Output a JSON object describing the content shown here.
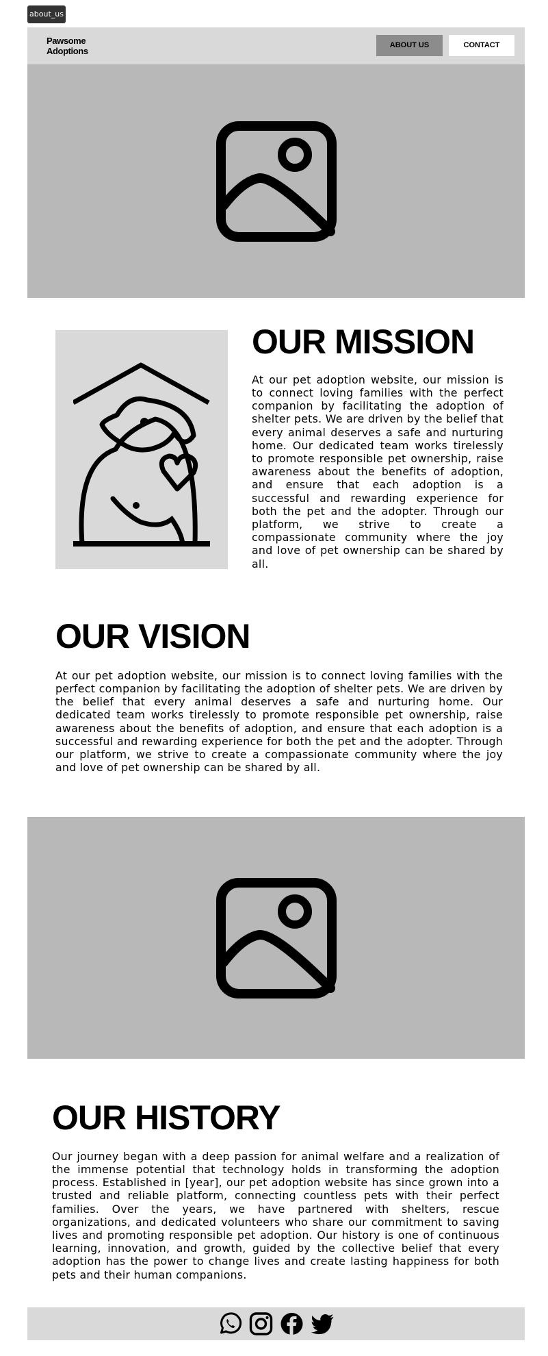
{
  "page_tag": "about_us",
  "navbar": {
    "brand_line1": "Pawsome",
    "brand_line2": "Adoptions",
    "links": [
      {
        "label": "ABOUT US",
        "active": true
      },
      {
        "label": "CONTACT",
        "active": false
      }
    ]
  },
  "hero": {
    "icon": "image-placeholder-icon"
  },
  "mission": {
    "illustration": "dog-house-heart-icon",
    "title": "OUR MISSION",
    "text": "At our pet adoption website, our mission is to connect loving families with the perfect companion by facilitating the adoption of shelter pets. We are driven by the belief that every animal deserves a safe and nurturing home. Our dedicated team works tirelessly to promote responsible pet ownership, raise awareness about the benefits of adoption, and ensure that each adoption is a successful and rewarding experience for both the pet and the adopter. Through our platform, we strive to create a compassionate community where the joy and love of pet ownership can be shared by all."
  },
  "vision": {
    "title": "OUR VISION",
    "text": "At our pet adoption website, our mission is to connect loving families with the perfect companion by facilitating the adoption of shelter pets. We are driven by the belief that every animal deserves a safe and nurturing home. Our dedicated team works tirelessly to promote responsible pet ownership, raise awareness about the benefits of adoption, and ensure that each adoption is a successful and rewarding experience for both the pet and the adopter. Through our platform, we strive to create a compassionate community where the joy and love of pet ownership can be shared by all."
  },
  "history": {
    "title": "OUR HISTORY",
    "text": "Our journey began with a deep passion for animal welfare and a realization of the immense potential that technology holds in transforming the adoption process. Established in [year], our pet adoption website has since grown into a trusted and reliable platform, connecting countless pets with their perfect families. Over the years, we have partnered with shelters, rescue organizations, and dedicated volunteers who share our commitment to saving lives and promoting responsible pet adoption. Our history is one of continuous learning, innovation, and growth, guided by the collective belief that every adoption has the power to change lives and create lasting happiness for both pets and their human companions."
  },
  "footer": {
    "social_icons": [
      "whatsapp-icon",
      "instagram-icon",
      "facebook-icon",
      "twitter-icon"
    ]
  },
  "colors": {
    "navbar_bg": "#d9d9d9",
    "hero_bg": "#b8b8b8",
    "active_nav_bg": "#8c8c8c",
    "text": "#000000"
  }
}
